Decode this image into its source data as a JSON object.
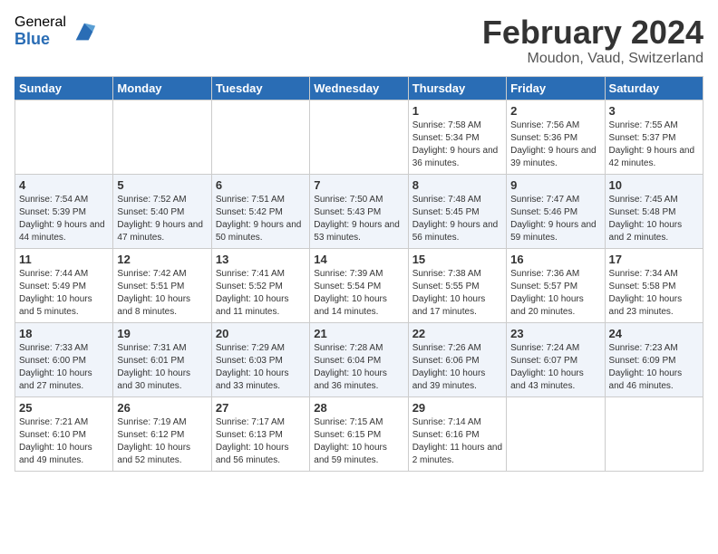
{
  "logo": {
    "general": "General",
    "blue": "Blue"
  },
  "title": "February 2024",
  "location": "Moudon, Vaud, Switzerland",
  "days_of_week": [
    "Sunday",
    "Monday",
    "Tuesday",
    "Wednesday",
    "Thursday",
    "Friday",
    "Saturday"
  ],
  "weeks": [
    [
      {
        "day": "",
        "info": ""
      },
      {
        "day": "",
        "info": ""
      },
      {
        "day": "",
        "info": ""
      },
      {
        "day": "",
        "info": ""
      },
      {
        "day": "1",
        "info": "Sunrise: 7:58 AM\nSunset: 5:34 PM\nDaylight: 9 hours\nand 36 minutes."
      },
      {
        "day": "2",
        "info": "Sunrise: 7:56 AM\nSunset: 5:36 PM\nDaylight: 9 hours\nand 39 minutes."
      },
      {
        "day": "3",
        "info": "Sunrise: 7:55 AM\nSunset: 5:37 PM\nDaylight: 9 hours\nand 42 minutes."
      }
    ],
    [
      {
        "day": "4",
        "info": "Sunrise: 7:54 AM\nSunset: 5:39 PM\nDaylight: 9 hours\nand 44 minutes."
      },
      {
        "day": "5",
        "info": "Sunrise: 7:52 AM\nSunset: 5:40 PM\nDaylight: 9 hours\nand 47 minutes."
      },
      {
        "day": "6",
        "info": "Sunrise: 7:51 AM\nSunset: 5:42 PM\nDaylight: 9 hours\nand 50 minutes."
      },
      {
        "day": "7",
        "info": "Sunrise: 7:50 AM\nSunset: 5:43 PM\nDaylight: 9 hours\nand 53 minutes."
      },
      {
        "day": "8",
        "info": "Sunrise: 7:48 AM\nSunset: 5:45 PM\nDaylight: 9 hours\nand 56 minutes."
      },
      {
        "day": "9",
        "info": "Sunrise: 7:47 AM\nSunset: 5:46 PM\nDaylight: 9 hours\nand 59 minutes."
      },
      {
        "day": "10",
        "info": "Sunrise: 7:45 AM\nSunset: 5:48 PM\nDaylight: 10 hours\nand 2 minutes."
      }
    ],
    [
      {
        "day": "11",
        "info": "Sunrise: 7:44 AM\nSunset: 5:49 PM\nDaylight: 10 hours\nand 5 minutes."
      },
      {
        "day": "12",
        "info": "Sunrise: 7:42 AM\nSunset: 5:51 PM\nDaylight: 10 hours\nand 8 minutes."
      },
      {
        "day": "13",
        "info": "Sunrise: 7:41 AM\nSunset: 5:52 PM\nDaylight: 10 hours\nand 11 minutes."
      },
      {
        "day": "14",
        "info": "Sunrise: 7:39 AM\nSunset: 5:54 PM\nDaylight: 10 hours\nand 14 minutes."
      },
      {
        "day": "15",
        "info": "Sunrise: 7:38 AM\nSunset: 5:55 PM\nDaylight: 10 hours\nand 17 minutes."
      },
      {
        "day": "16",
        "info": "Sunrise: 7:36 AM\nSunset: 5:57 PM\nDaylight: 10 hours\nand 20 minutes."
      },
      {
        "day": "17",
        "info": "Sunrise: 7:34 AM\nSunset: 5:58 PM\nDaylight: 10 hours\nand 23 minutes."
      }
    ],
    [
      {
        "day": "18",
        "info": "Sunrise: 7:33 AM\nSunset: 6:00 PM\nDaylight: 10 hours\nand 27 minutes."
      },
      {
        "day": "19",
        "info": "Sunrise: 7:31 AM\nSunset: 6:01 PM\nDaylight: 10 hours\nand 30 minutes."
      },
      {
        "day": "20",
        "info": "Sunrise: 7:29 AM\nSunset: 6:03 PM\nDaylight: 10 hours\nand 33 minutes."
      },
      {
        "day": "21",
        "info": "Sunrise: 7:28 AM\nSunset: 6:04 PM\nDaylight: 10 hours\nand 36 minutes."
      },
      {
        "day": "22",
        "info": "Sunrise: 7:26 AM\nSunset: 6:06 PM\nDaylight: 10 hours\nand 39 minutes."
      },
      {
        "day": "23",
        "info": "Sunrise: 7:24 AM\nSunset: 6:07 PM\nDaylight: 10 hours\nand 43 minutes."
      },
      {
        "day": "24",
        "info": "Sunrise: 7:23 AM\nSunset: 6:09 PM\nDaylight: 10 hours\nand 46 minutes."
      }
    ],
    [
      {
        "day": "25",
        "info": "Sunrise: 7:21 AM\nSunset: 6:10 PM\nDaylight: 10 hours\nand 49 minutes."
      },
      {
        "day": "26",
        "info": "Sunrise: 7:19 AM\nSunset: 6:12 PM\nDaylight: 10 hours\nand 52 minutes."
      },
      {
        "day": "27",
        "info": "Sunrise: 7:17 AM\nSunset: 6:13 PM\nDaylight: 10 hours\nand 56 minutes."
      },
      {
        "day": "28",
        "info": "Sunrise: 7:15 AM\nSunset: 6:15 PM\nDaylight: 10 hours\nand 59 minutes."
      },
      {
        "day": "29",
        "info": "Sunrise: 7:14 AM\nSunset: 6:16 PM\nDaylight: 11 hours\nand 2 minutes."
      },
      {
        "day": "",
        "info": ""
      },
      {
        "day": "",
        "info": ""
      }
    ]
  ]
}
